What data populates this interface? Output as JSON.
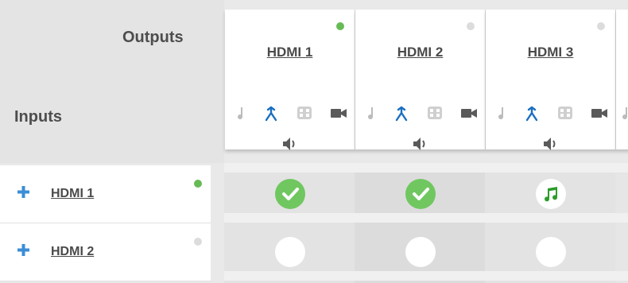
{
  "matrix": {
    "outputs_label": "Outputs",
    "inputs_label": "Inputs"
  },
  "colors": {
    "online": "#66bb55",
    "offline": "#dcdcdc",
    "route_selected": "#1a6fc2",
    "icon_inactive": "#bbbbbb",
    "check_fill": "#70c760",
    "audio_note": "#2a9d2a",
    "plus": "#3b8ed6"
  },
  "outputs": [
    {
      "name": "HDMI 1",
      "status": "online",
      "icons": [
        "audio-note-icon",
        "merge-route-icon",
        "grid-pattern-icon",
        "video-camera-icon",
        "speaker-icon"
      ]
    },
    {
      "name": "HDMI 2",
      "status": "offline",
      "icons": [
        "audio-note-icon",
        "merge-route-icon",
        "grid-pattern-icon",
        "video-camera-icon",
        "speaker-icon"
      ]
    },
    {
      "name": "HDMI 3",
      "status": "offline",
      "icons": [
        "audio-note-icon",
        "merge-route-icon",
        "grid-pattern-icon",
        "video-camera-icon",
        "speaker-icon"
      ]
    }
  ],
  "inputs": [
    {
      "name": "HDMI 1",
      "status": "online"
    },
    {
      "name": "HDMI 2",
      "status": "offline"
    }
  ],
  "routes": [
    [
      "av",
      "av",
      "audio"
    ],
    [
      "none",
      "none",
      "none"
    ]
  ]
}
